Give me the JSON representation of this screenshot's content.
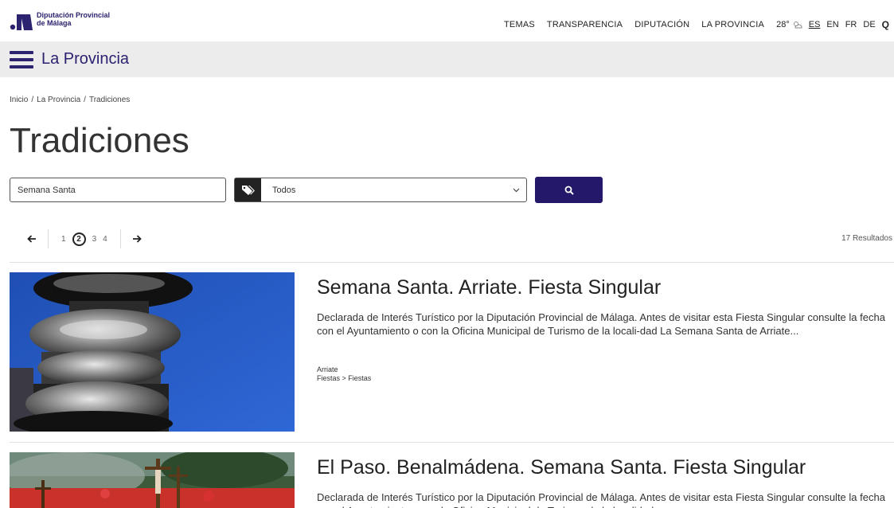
{
  "brand": {
    "name_line1": "Diputación Provincial",
    "name_line2": "de Málaga",
    "color": "#2b2270"
  },
  "topnav": {
    "items": [
      "TEMAS",
      "TRANSPARENCIA",
      "DIPUTACIÓN",
      "LA PROVINCIA"
    ],
    "weather": "28°",
    "languages": [
      "ES",
      "EN",
      "FR",
      "DE"
    ],
    "active_language": "ES",
    "search_glyph": "Q"
  },
  "section": {
    "title": "La Provincia"
  },
  "breadcrumb": [
    "Inicio",
    "La Provincia",
    "Tradiciones"
  ],
  "page": {
    "title": "Tradiciones"
  },
  "filters": {
    "search_value": "Semana Santa",
    "category_value": "Todos",
    "button_icon": "search-icon",
    "button_color": "#23186a"
  },
  "pagination": {
    "pages": [
      "1",
      "2",
      "3",
      "4"
    ],
    "current": "2"
  },
  "results_count": "17 Resultados",
  "results": [
    {
      "title": "Semana Santa. Arriate. Fiesta Singular",
      "description": "Declarada de Interés Turístico por la Diputación Provincial de Málaga.  Antes de visitar esta Fiesta Singular consulte la fecha con el Ayuntamiento o con la Oficina Municipal de Turismo de la locali-dad La Semana Santa de Arriate...",
      "location": "Arriate",
      "category": "Fiestas > Fiestas"
    },
    {
      "title": "El Paso. Benalmádena. Semana Santa. Fiesta Singular",
      "description": "Declarada de Interés Turístico por la Diputación Provincial de Málaga.  Antes de visitar esta Fiesta Singular consulte la fecha con el Ayuntamiento o con la Oficina Municipal de Turismo de la localidad."
    }
  ]
}
